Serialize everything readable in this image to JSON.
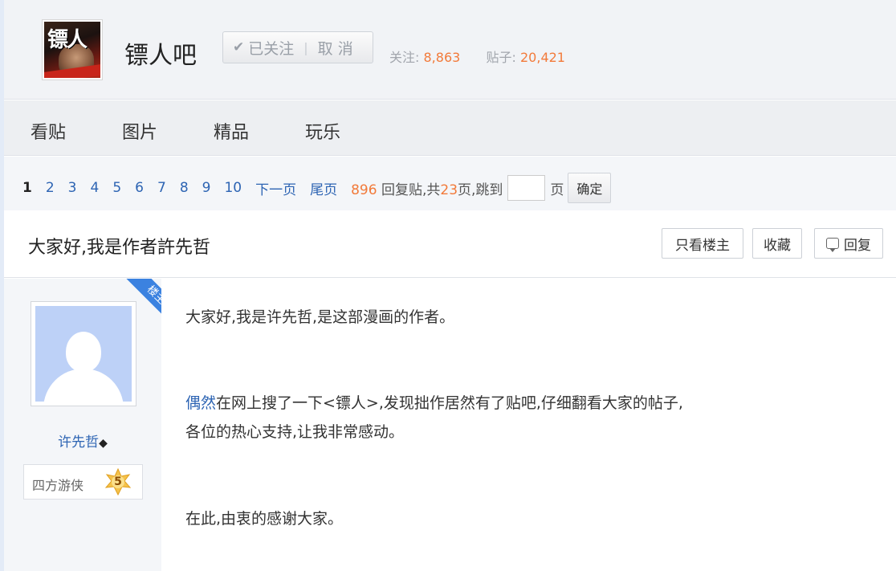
{
  "forum": {
    "name": "镖人吧",
    "follow_label": "已关注",
    "cancel_label": "取 消",
    "followers_label": "关注:",
    "followers": "8,863",
    "posts_label": "贴子:",
    "posts": "20,421",
    "logo_text": "镖人"
  },
  "nav": [
    "看贴",
    "图片",
    "精品",
    "玩乐"
  ],
  "pager": {
    "pages": [
      "1",
      "2",
      "3",
      "4",
      "5",
      "6",
      "7",
      "8",
      "9",
      "10"
    ],
    "current": "1",
    "next": "下一页",
    "last": "尾页",
    "reply_count": "896",
    "reply_suffix": "回复贴,共",
    "total_pages": "23",
    "page_suffix": "页,跳到",
    "page_unit": "页",
    "confirm": "确定"
  },
  "thread": {
    "title": "大家好,我是作者許先哲",
    "only_op": "只看楼主",
    "favorite": "收藏",
    "reply": "回复"
  },
  "post": {
    "op_badge": "楼主",
    "username": "许先哲",
    "diamond": "◆",
    "rank_title": "四方游侠",
    "level": "5",
    "line1": "大家好,我是许先哲,是这部漫画的作者。",
    "line2_link": "偶然",
    "line2_rest": "在网上搜了一下<镖人>,发现拙作居然有了贴吧,仔细翻看大家的帖子,",
    "line3": "各位的热心支持,让我非常感动。",
    "line4": "在此,由衷的感谢大家。"
  },
  "colors": {
    "accent": "#f27a3a",
    "link": "#2d64b3",
    "op_ribbon": "#3b82e0"
  }
}
